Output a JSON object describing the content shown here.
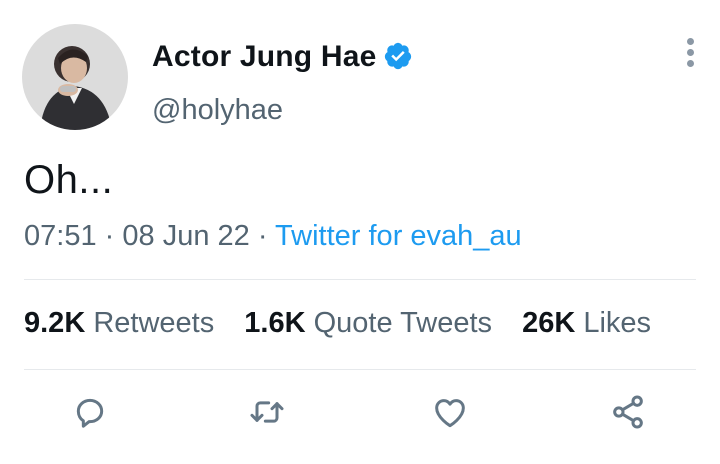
{
  "tweet": {
    "display_name": "Actor Jung Hae",
    "handle": "@holyhae",
    "text": "Oh...",
    "time": "07:51",
    "date": "08 Jun 22",
    "separator": "·",
    "source": "Twitter for evah_au",
    "verified": true
  },
  "stats": {
    "retweets_count": "9.2K",
    "retweets_label": "Retweets",
    "quotes_count": "1.6K",
    "quotes_label": "Quote Tweets",
    "likes_count": "26K",
    "likes_label": "Likes"
  },
  "icons": {
    "verified": "verified-badge-icon",
    "more": "more-vertical-icon",
    "reply": "reply-icon",
    "retweet": "retweet-icon",
    "like": "heart-icon",
    "share": "share-icon"
  },
  "colors": {
    "accent": "#1d9bf0",
    "secondary_text": "#536471",
    "icon_gray": "#657786"
  }
}
